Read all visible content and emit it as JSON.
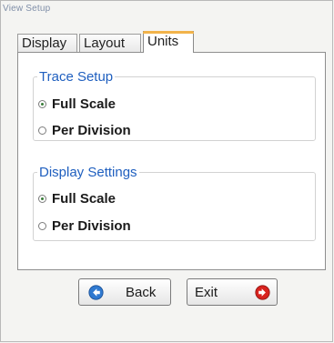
{
  "window": {
    "title": "View Setup"
  },
  "tabs": [
    {
      "label": "Display"
    },
    {
      "label": "Layout"
    },
    {
      "label": "Units"
    }
  ],
  "trace_setup": {
    "title": "Trace Setup",
    "options": [
      {
        "label": "Full Scale",
        "selected": true
      },
      {
        "label": "Per Division",
        "selected": false
      }
    ]
  },
  "display_settings": {
    "title": "Display Settings",
    "options": [
      {
        "label": "Full Scale",
        "selected": true
      },
      {
        "label": "Per Division",
        "selected": false
      }
    ]
  },
  "buttons": {
    "back": {
      "label": "Back",
      "icon": "arrow-left-icon",
      "color": "#2f79d0"
    },
    "exit": {
      "label": "Exit",
      "icon": "arrow-right-icon",
      "color": "#d8231f"
    }
  }
}
